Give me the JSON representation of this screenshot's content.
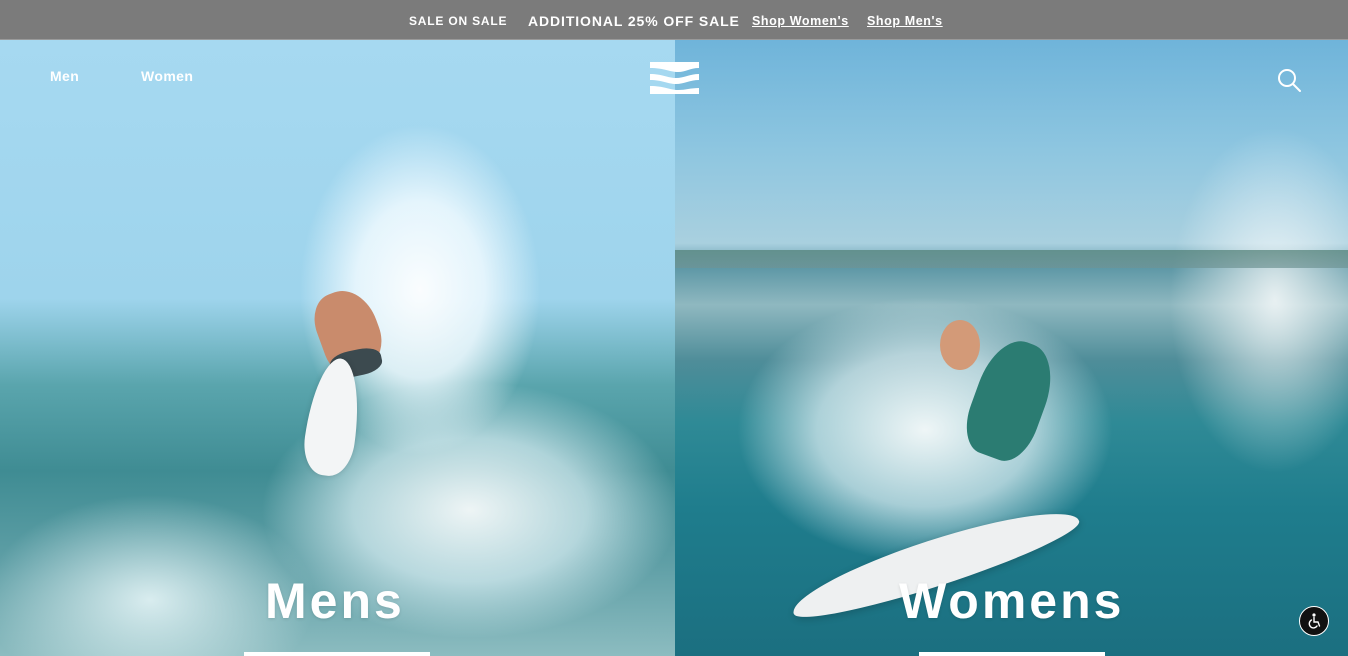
{
  "promo": {
    "sale_on_sale": "SALE ON SALE",
    "additional": "ADDITIONAL 25% OFF SALE",
    "shop_women": "Shop Women's",
    "shop_men": "Shop Men's"
  },
  "header": {
    "nav": [
      "Men",
      "Women"
    ],
    "logo_icon": "billabong-logo-icon",
    "search_icon": "search-icon"
  },
  "hero": {
    "left_title": "Mens",
    "right_title": "Womens"
  },
  "accessibility": {
    "icon": "wheelchair-accessibility-icon"
  },
  "colors": {
    "promo_bar": "#7b7b7b",
    "text": "#ffffff"
  }
}
